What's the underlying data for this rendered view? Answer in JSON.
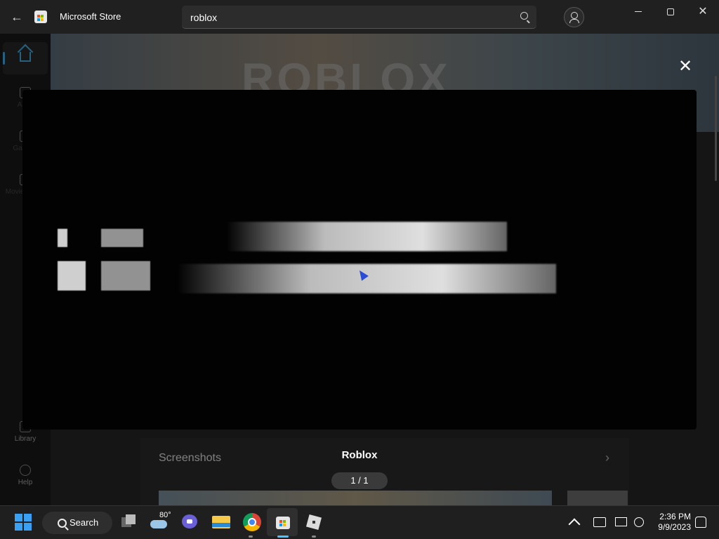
{
  "app": {
    "title": "Microsoft Store"
  },
  "search": {
    "value": "roblox"
  },
  "sidebar": {
    "items": [
      {
        "label": "Home",
        "icon": "home-icon"
      },
      {
        "label": "Apps",
        "icon": "apps-icon"
      },
      {
        "label": "Gaming",
        "icon": "gaming-icon"
      },
      {
        "label": "Movies & TV",
        "icon": "movies-icon"
      },
      {
        "label": "Library",
        "icon": "library-icon"
      },
      {
        "label": "Help",
        "icon": "help-icon"
      }
    ]
  },
  "store_page": {
    "hero_word": "ROBLOX",
    "screenshots_heading": "Screenshots"
  },
  "modal": {
    "title": "Roblox",
    "pager": "1 / 1"
  },
  "taskbar": {
    "search_label": "Search",
    "weather_temp": "80°",
    "time": "2:36 PM",
    "date": "9/9/2023"
  },
  "colors": {
    "accent": "#4cc2ff",
    "background": "#202020",
    "cursor": "#2a4bd6"
  }
}
